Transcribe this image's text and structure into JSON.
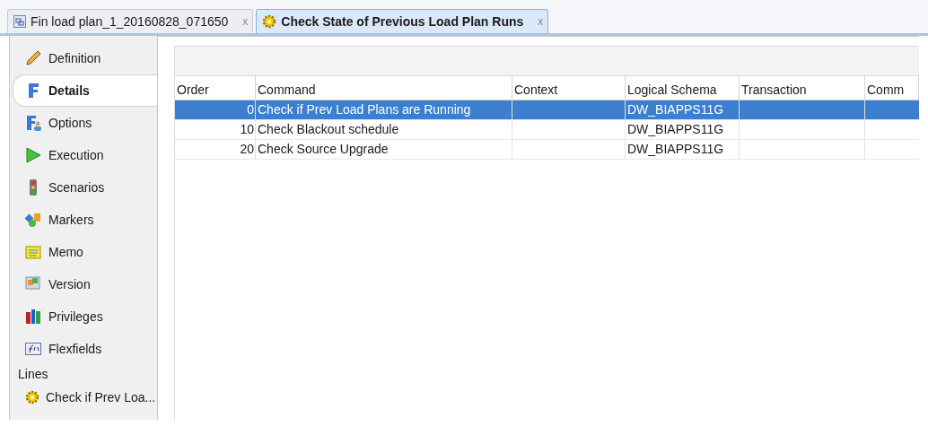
{
  "tabs": [
    {
      "label": "Fin load plan_1_20160828_071650",
      "close": "x",
      "selected": false
    },
    {
      "label": "Check State of Previous Load Plan Runs",
      "close": "x",
      "selected": true
    }
  ],
  "sidebar": {
    "items": [
      {
        "label": "Definition",
        "selected": false
      },
      {
        "label": "Details",
        "selected": true
      },
      {
        "label": "Options",
        "selected": false
      },
      {
        "label": "Execution",
        "selected": false
      },
      {
        "label": "Scenarios",
        "selected": false
      },
      {
        "label": "Markers",
        "selected": false
      },
      {
        "label": "Memo",
        "selected": false
      },
      {
        "label": "Version",
        "selected": false
      },
      {
        "label": "Privileges",
        "selected": false
      },
      {
        "label": "Flexfields",
        "selected": false
      }
    ],
    "section": "Lines",
    "lines": [
      {
        "label": "Check if Prev Loa...",
        "selected": false
      }
    ]
  },
  "table": {
    "columns": [
      "Order",
      "Command",
      "Context",
      "Logical Schema",
      "Transaction",
      "Comm"
    ],
    "rows": [
      {
        "order": "0",
        "command": "Check if Prev Load Plans are Running",
        "logical_schema": "DW_BIAPPS11G",
        "selected": true
      },
      {
        "order": "10",
        "command": "Check Blackout schedule",
        "logical_schema": "DW_BIAPPS11G",
        "selected": false
      },
      {
        "order": "20",
        "command": "Check Source Upgrade",
        "logical_schema": "DW_BIAPPS11G",
        "selected": false
      }
    ]
  }
}
